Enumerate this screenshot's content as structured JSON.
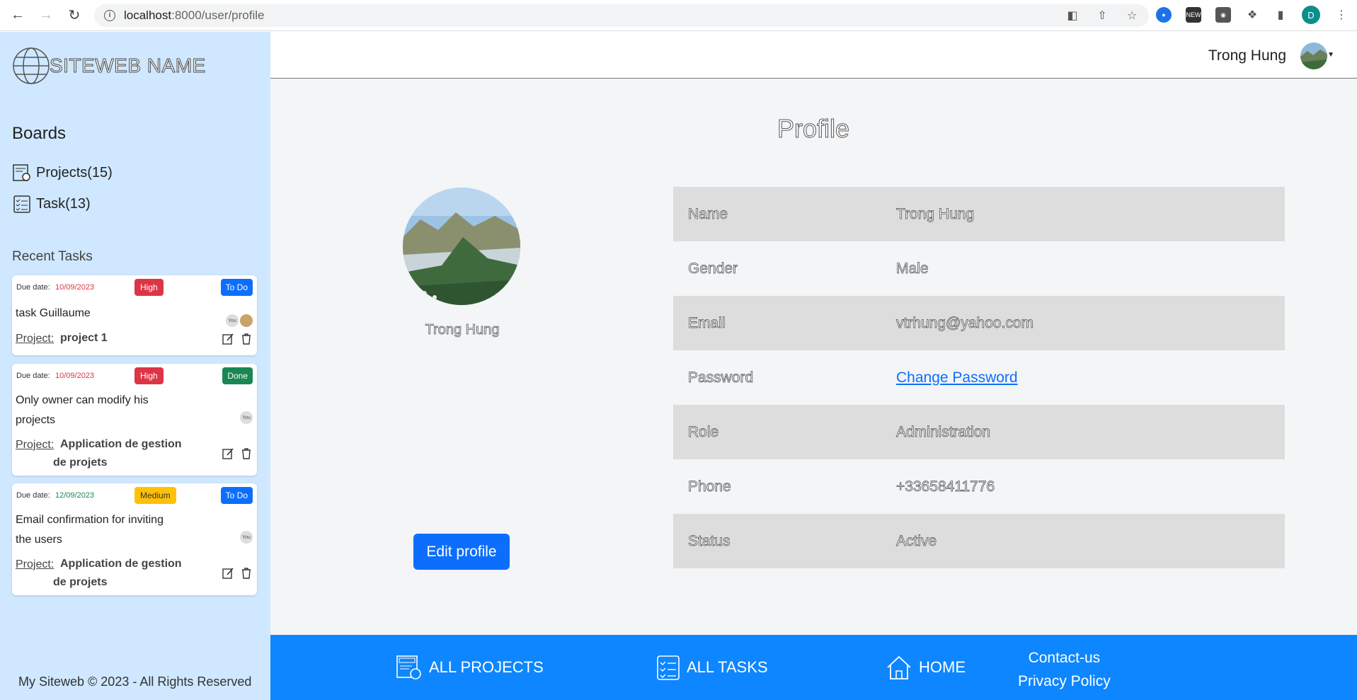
{
  "browser": {
    "url_host": "localhost",
    "url_rest": ":8000/user/profile",
    "profile_initial": "D"
  },
  "sidebar": {
    "logo_text": "SITEWEB NAME",
    "boards_title": "Boards",
    "projects_link": "Projects(15)",
    "tasks_link": "Task(13)",
    "recent_title": "Recent Tasks",
    "copyright": "My Siteweb © 2023 - All Rights Reserved",
    "tasks": [
      {
        "due_label": "Due date:",
        "due_date": "10/09/2023",
        "priority": "High",
        "status": "To Do",
        "title": "task Guillaume",
        "avatar_label": "You",
        "project_label": "Project:",
        "project_name": "project 1"
      },
      {
        "due_label": "Due date:",
        "due_date": "10/09/2023",
        "priority": "High",
        "status": "Done",
        "title": "Only owner can modify his projects",
        "avatar_label": "You",
        "project_label": "Project:",
        "project_name": "Application de gestion de projets"
      },
      {
        "due_label": "Due date:",
        "due_date": "12/09/2023",
        "priority": "Medium",
        "status": "To Do",
        "title": "Email confirmation for inviting the users",
        "avatar_label": "You",
        "project_label": "Project:",
        "project_name": "Application de gestion de projets"
      }
    ]
  },
  "header": {
    "user_name": "Trong Hung"
  },
  "profile": {
    "title": "Profile",
    "avatar_name": "Trong Hung",
    "edit_button": "Edit profile",
    "fields": [
      {
        "key": "Name",
        "value": "Trong Hung"
      },
      {
        "key": "Gender",
        "value": "Male"
      },
      {
        "key": "Email",
        "value": "vtrhung@yahoo.com"
      },
      {
        "key": "Password",
        "value": "Change Password"
      },
      {
        "key": "Role",
        "value": "Administration"
      },
      {
        "key": "Phone",
        "value": "+33658411776"
      },
      {
        "key": "Status",
        "value": "Active"
      }
    ]
  },
  "footer": {
    "all_projects": "ALL PROJECTS",
    "all_tasks": "ALL TASKS",
    "home": "HOME",
    "contact": "Contact-us",
    "privacy": "Privacy Policy"
  },
  "colors": {
    "sidebar_bg": "#cfe8ff",
    "primary": "#0d6efd",
    "footer_bg": "#0d86ff",
    "high": "#dc3545",
    "medium": "#ffc107",
    "done": "#198754"
  }
}
